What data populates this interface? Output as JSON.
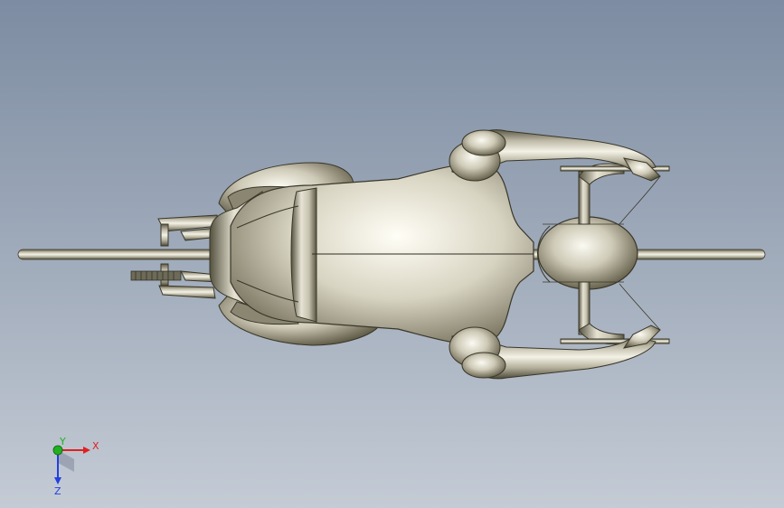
{
  "viewport": {
    "background_top": "#7d8ca2",
    "background_bottom": "#c4cbd5"
  },
  "model": {
    "description_icon": "3d-model-render"
  },
  "triad": {
    "x_label": "X",
    "y_label": "Y",
    "z_label": "Z",
    "x_color": "#e02020",
    "y_color": "#20b020",
    "z_color": "#2040e0"
  }
}
